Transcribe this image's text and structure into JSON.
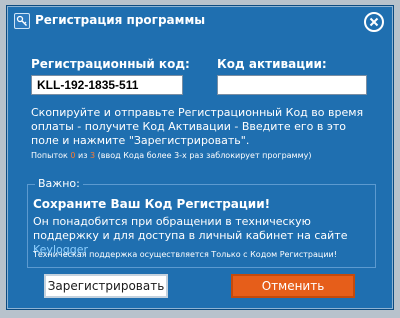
{
  "window": {
    "title": "Регистрация программы"
  },
  "registration": {
    "code_label": "Регистрационный код:",
    "code_value": "KLL-192-1835-511",
    "activation_label": "Код активации:",
    "activation_value": ""
  },
  "instructions": {
    "text": "Скопируйте и отправьте Регистрационный Код во время оплаты - получите Код Активации - Введите его в это поле и нажмите \"Зарегистрировать\"."
  },
  "attempts": {
    "prefix": "Попыток",
    "used": "0",
    "of": "из",
    "total": "3",
    "suffix": "(ввод Кода более 3-х раз заблокирует программу)"
  },
  "important": {
    "legend": "Важно:",
    "heading": "Сохраните Ваш Код Регистрации!",
    "body_text": "Он понадобится при обращении в техническую поддержку и для доступа в личный кабинет на сайте ",
    "link_text": "Keylogger",
    "support_note": "Техническая поддержка осуществляется Только с Кодом Регистрации!"
  },
  "buttons": {
    "register_label": "Зарегистрировать",
    "cancel_label": "Отменить"
  },
  "colors": {
    "dialog_background": "#1f6fb0",
    "cancel_button": "#e65e1a",
    "attempt_numbers": "#ff7a2e",
    "link": "#8fd0ff"
  },
  "icons": {
    "app": "app-key-icon",
    "close": "close-icon"
  }
}
